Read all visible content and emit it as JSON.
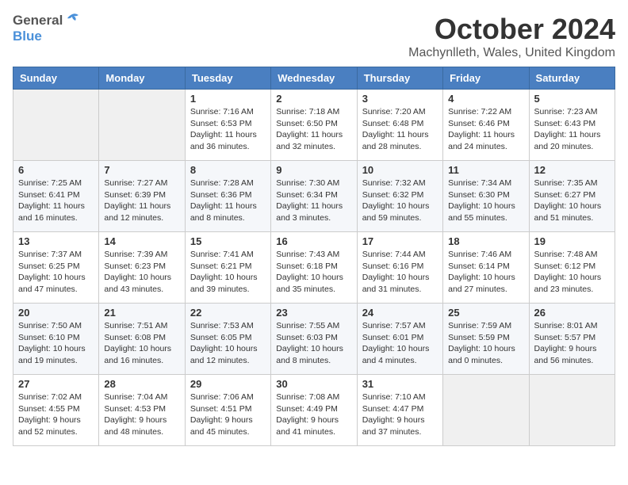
{
  "header": {
    "logo_general": "General",
    "logo_blue": "Blue",
    "month": "October 2024",
    "location": "Machynlleth, Wales, United Kingdom"
  },
  "weekdays": [
    "Sunday",
    "Monday",
    "Tuesday",
    "Wednesday",
    "Thursday",
    "Friday",
    "Saturday"
  ],
  "weeks": [
    [
      {
        "day": "",
        "info": ""
      },
      {
        "day": "",
        "info": ""
      },
      {
        "day": "1",
        "info": "Sunrise: 7:16 AM\nSunset: 6:53 PM\nDaylight: 11 hours\nand 36 minutes."
      },
      {
        "day": "2",
        "info": "Sunrise: 7:18 AM\nSunset: 6:50 PM\nDaylight: 11 hours\nand 32 minutes."
      },
      {
        "day": "3",
        "info": "Sunrise: 7:20 AM\nSunset: 6:48 PM\nDaylight: 11 hours\nand 28 minutes."
      },
      {
        "day": "4",
        "info": "Sunrise: 7:22 AM\nSunset: 6:46 PM\nDaylight: 11 hours\nand 24 minutes."
      },
      {
        "day": "5",
        "info": "Sunrise: 7:23 AM\nSunset: 6:43 PM\nDaylight: 11 hours\nand 20 minutes."
      }
    ],
    [
      {
        "day": "6",
        "info": "Sunrise: 7:25 AM\nSunset: 6:41 PM\nDaylight: 11 hours\nand 16 minutes."
      },
      {
        "day": "7",
        "info": "Sunrise: 7:27 AM\nSunset: 6:39 PM\nDaylight: 11 hours\nand 12 minutes."
      },
      {
        "day": "8",
        "info": "Sunrise: 7:28 AM\nSunset: 6:36 PM\nDaylight: 11 hours\nand 8 minutes."
      },
      {
        "day": "9",
        "info": "Sunrise: 7:30 AM\nSunset: 6:34 PM\nDaylight: 11 hours\nand 3 minutes."
      },
      {
        "day": "10",
        "info": "Sunrise: 7:32 AM\nSunset: 6:32 PM\nDaylight: 10 hours\nand 59 minutes."
      },
      {
        "day": "11",
        "info": "Sunrise: 7:34 AM\nSunset: 6:30 PM\nDaylight: 10 hours\nand 55 minutes."
      },
      {
        "day": "12",
        "info": "Sunrise: 7:35 AM\nSunset: 6:27 PM\nDaylight: 10 hours\nand 51 minutes."
      }
    ],
    [
      {
        "day": "13",
        "info": "Sunrise: 7:37 AM\nSunset: 6:25 PM\nDaylight: 10 hours\nand 47 minutes."
      },
      {
        "day": "14",
        "info": "Sunrise: 7:39 AM\nSunset: 6:23 PM\nDaylight: 10 hours\nand 43 minutes."
      },
      {
        "day": "15",
        "info": "Sunrise: 7:41 AM\nSunset: 6:21 PM\nDaylight: 10 hours\nand 39 minutes."
      },
      {
        "day": "16",
        "info": "Sunrise: 7:43 AM\nSunset: 6:18 PM\nDaylight: 10 hours\nand 35 minutes."
      },
      {
        "day": "17",
        "info": "Sunrise: 7:44 AM\nSunset: 6:16 PM\nDaylight: 10 hours\nand 31 minutes."
      },
      {
        "day": "18",
        "info": "Sunrise: 7:46 AM\nSunset: 6:14 PM\nDaylight: 10 hours\nand 27 minutes."
      },
      {
        "day": "19",
        "info": "Sunrise: 7:48 AM\nSunset: 6:12 PM\nDaylight: 10 hours\nand 23 minutes."
      }
    ],
    [
      {
        "day": "20",
        "info": "Sunrise: 7:50 AM\nSunset: 6:10 PM\nDaylight: 10 hours\nand 19 minutes."
      },
      {
        "day": "21",
        "info": "Sunrise: 7:51 AM\nSunset: 6:08 PM\nDaylight: 10 hours\nand 16 minutes."
      },
      {
        "day": "22",
        "info": "Sunrise: 7:53 AM\nSunset: 6:05 PM\nDaylight: 10 hours\nand 12 minutes."
      },
      {
        "day": "23",
        "info": "Sunrise: 7:55 AM\nSunset: 6:03 PM\nDaylight: 10 hours\nand 8 minutes."
      },
      {
        "day": "24",
        "info": "Sunrise: 7:57 AM\nSunset: 6:01 PM\nDaylight: 10 hours\nand 4 minutes."
      },
      {
        "day": "25",
        "info": "Sunrise: 7:59 AM\nSunset: 5:59 PM\nDaylight: 10 hours\nand 0 minutes."
      },
      {
        "day": "26",
        "info": "Sunrise: 8:01 AM\nSunset: 5:57 PM\nDaylight: 9 hours\nand 56 minutes."
      }
    ],
    [
      {
        "day": "27",
        "info": "Sunrise: 7:02 AM\nSunset: 4:55 PM\nDaylight: 9 hours\nand 52 minutes."
      },
      {
        "day": "28",
        "info": "Sunrise: 7:04 AM\nSunset: 4:53 PM\nDaylight: 9 hours\nand 48 minutes."
      },
      {
        "day": "29",
        "info": "Sunrise: 7:06 AM\nSunset: 4:51 PM\nDaylight: 9 hours\nand 45 minutes."
      },
      {
        "day": "30",
        "info": "Sunrise: 7:08 AM\nSunset: 4:49 PM\nDaylight: 9 hours\nand 41 minutes."
      },
      {
        "day": "31",
        "info": "Sunrise: 7:10 AM\nSunset: 4:47 PM\nDaylight: 9 hours\nand 37 minutes."
      },
      {
        "day": "",
        "info": ""
      },
      {
        "day": "",
        "info": ""
      }
    ]
  ]
}
